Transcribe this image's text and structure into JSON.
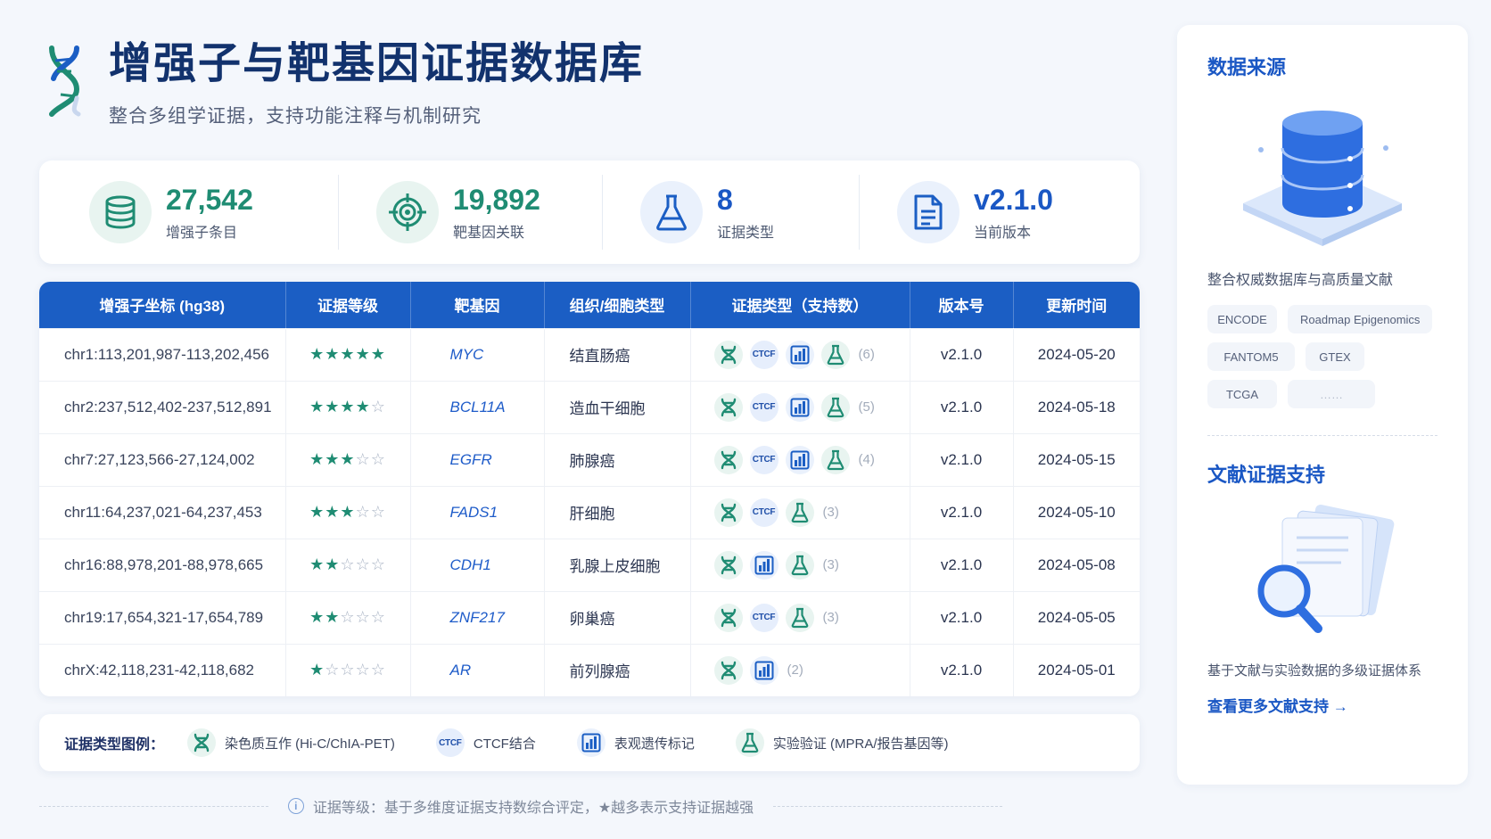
{
  "header": {
    "title": "增强子与靶基因证据数据库",
    "subtitle": "整合多组学证据，支持功能注释与机制研究"
  },
  "stats": [
    {
      "value": "27,542",
      "label": "增强子条目",
      "icon": "database-icon",
      "color": "#1f8c73"
    },
    {
      "value": "19,892",
      "label": "靶基因关联",
      "icon": "target-icon",
      "color": "#1f8c73"
    },
    {
      "value": "8",
      "label": "证据类型",
      "icon": "flask-icon",
      "color": "#1a57c4"
    },
    {
      "value": "v2.1.0",
      "label": "当前版本",
      "icon": "document-icon",
      "color": "#1a57c4"
    }
  ],
  "table": {
    "headers": [
      "增强子坐标 (hg38)",
      "证据等级",
      "靶基因",
      "组织/细胞类型",
      "证据类型（支持数）",
      "版本号",
      "更新时间"
    ],
    "rows": [
      {
        "coord": "chr1:113,201,987-113,202,456",
        "level": 5,
        "gene": "MYC",
        "tissue": "结直肠癌",
        "ev": [
          "chromatin",
          "ctcf",
          "epigenetic",
          "experiment"
        ],
        "count": "(6)",
        "version": "v2.1.0",
        "date": "2024-05-20"
      },
      {
        "coord": "chr2:237,512,402-237,512,891",
        "level": 4,
        "gene": "BCL11A",
        "tissue": "造血干细胞",
        "ev": [
          "chromatin",
          "ctcf",
          "epigenetic",
          "experiment"
        ],
        "count": "(5)",
        "version": "v2.1.0",
        "date": "2024-05-18"
      },
      {
        "coord": "chr7:27,123,566-27,124,002",
        "level": 3,
        "gene": "EGFR",
        "tissue": "肺腺癌",
        "ev": [
          "chromatin",
          "ctcf",
          "epigenetic",
          "experiment"
        ],
        "count": "(4)",
        "version": "v2.1.0",
        "date": "2024-05-15"
      },
      {
        "coord": "chr11:64,237,021-64,237,453",
        "level": 3,
        "gene": "FADS1",
        "tissue": "肝细胞",
        "ev": [
          "chromatin",
          "ctcf",
          "experiment"
        ],
        "count": "(3)",
        "version": "v2.1.0",
        "date": "2024-05-10"
      },
      {
        "coord": "chr16:88,978,201-88,978,665",
        "level": 2,
        "gene": "CDH1",
        "tissue": "乳腺上皮细胞",
        "ev": [
          "chromatin",
          "epigenetic",
          "experiment"
        ],
        "count": "(3)",
        "version": "v2.1.0",
        "date": "2024-05-08"
      },
      {
        "coord": "chr19:17,654,321-17,654,789",
        "level": 2,
        "gene": "ZNF217",
        "tissue": "卵巢癌",
        "ev": [
          "chromatin",
          "ctcf",
          "experiment"
        ],
        "count": "(3)",
        "version": "v2.1.0",
        "date": "2024-05-05"
      },
      {
        "coord": "chrX:42,118,231-42,118,682",
        "level": 1,
        "gene": "AR",
        "tissue": "前列腺癌",
        "ev": [
          "chromatin",
          "epigenetic"
        ],
        "count": "(2)",
        "version": "v2.1.0",
        "date": "2024-05-01"
      }
    ]
  },
  "legend": {
    "title": "证据类型图例：",
    "items": [
      {
        "type": "chromatin",
        "label": "染色质互作 (Hi-C/ChIA-PET)"
      },
      {
        "type": "ctcf",
        "label": "CTCF结合"
      },
      {
        "type": "epigenetic",
        "label": "表观遗传标记"
      },
      {
        "type": "experiment",
        "label": "实验验证 (MPRA/报告基因等)"
      }
    ]
  },
  "ctcf_text": "CTCF",
  "footer": {
    "note": "证据等级：基于多维度证据支持数综合评定，★越多表示支持证据越强",
    "info_glyph": "i"
  },
  "sidebar": {
    "sources_title": "数据来源",
    "sources_desc": "整合权威数据库与高质量文献",
    "tags": [
      "ENCODE",
      "Roadmap Epigenomics",
      "FANTOM5",
      "GTEX",
      "TCGA",
      "……"
    ],
    "lit_title": "文献证据支持",
    "lit_desc": "基于文献与实验数据的多级证据体系",
    "lit_link": "查看更多文献支持 →"
  },
  "colors": {
    "accent": "#1b5ec4",
    "teal": "#1f8c73",
    "title": "#12326d"
  }
}
